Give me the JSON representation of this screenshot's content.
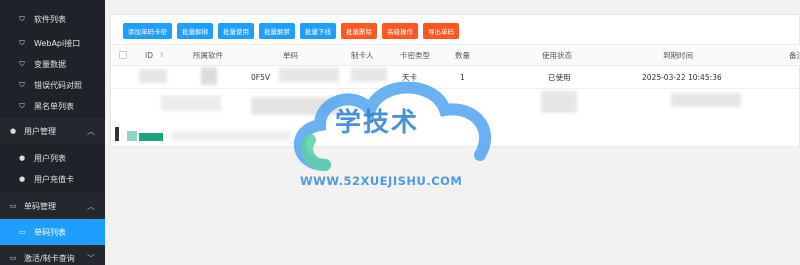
{
  "sidebar": {
    "items": [
      {
        "label": "软件列表",
        "icon": "shield-icon",
        "kind": "child"
      },
      {
        "label": "WebApi接口",
        "icon": "shield-icon",
        "kind": "child"
      },
      {
        "label": "变量数据",
        "icon": "shield-icon",
        "kind": "child"
      },
      {
        "label": "错误代码对照",
        "icon": "shield-icon",
        "kind": "child"
      },
      {
        "label": "黑名单列表",
        "icon": "shield-icon",
        "kind": "child"
      },
      {
        "label": "用户管理",
        "icon": "user-icon",
        "kind": "group"
      },
      {
        "label": "用户列表",
        "icon": "user-icon",
        "kind": "child"
      },
      {
        "label": "用户充值卡",
        "icon": "user-icon",
        "kind": "child"
      },
      {
        "label": "单码管理",
        "icon": "card-icon",
        "kind": "group"
      },
      {
        "label": "单码列表",
        "icon": "card-icon",
        "kind": "child",
        "active": true
      },
      {
        "label": "激活/制卡查询",
        "icon": "card-icon",
        "kind": "group"
      }
    ]
  },
  "toolbar": {
    "buttons": [
      {
        "label": "添加单码卡密",
        "color": "#1e9fff"
      },
      {
        "label": "批量解绑",
        "color": "#1e9fff"
      },
      {
        "label": "批量使用",
        "color": "#1e9fff"
      },
      {
        "label": "批量解禁",
        "color": "#1e9fff"
      },
      {
        "label": "批量下线",
        "color": "#1e9fff"
      },
      {
        "label": "批量删除",
        "color": "#ff5722"
      },
      {
        "label": "高级操作",
        "color": "#ff5722"
      },
      {
        "label": "导出单码",
        "color": "#ff5722"
      }
    ]
  },
  "table": {
    "columns": [
      "ID",
      "所属软件",
      "单码",
      "制卡人",
      "卡密类型",
      "数量",
      "使用状态",
      "到期时间",
      "备注"
    ],
    "sort_icon": "sort-icon",
    "rows": [
      {
        "id": "",
        "software": "",
        "code": "0F5V",
        "maker": "",
        "type": "天卡",
        "count": "1",
        "status": "已使用",
        "expire": "2025-03-22 10:45:36",
        "remark": ""
      }
    ]
  },
  "watermark": {
    "title": "学技术",
    "url": "WWW.52XUEJISHU.COM"
  },
  "colors": {
    "sidebar_bg": "#1f2329",
    "accent": "#1e9fff",
    "danger": "#ff5722"
  }
}
